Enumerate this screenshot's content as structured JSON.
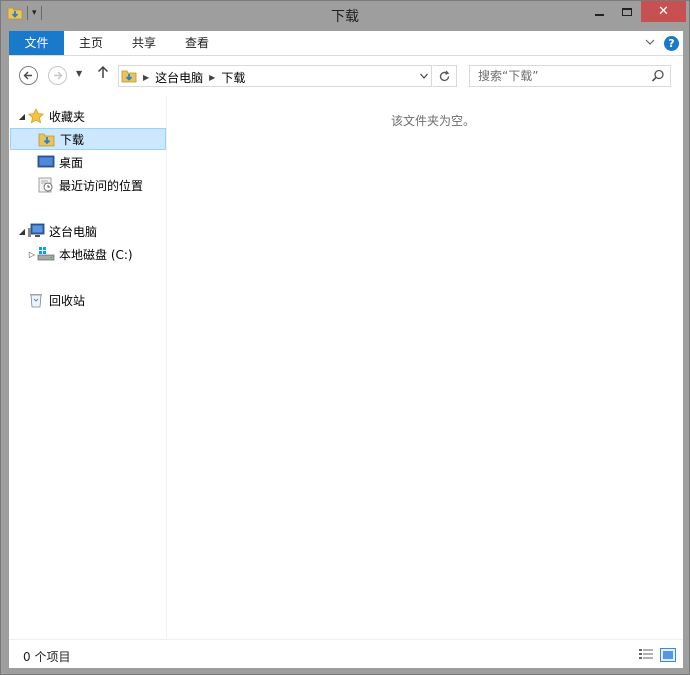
{
  "window": {
    "title": "下载"
  },
  "ribbon": {
    "tabs": [
      {
        "label": "文件"
      },
      {
        "label": "主页"
      },
      {
        "label": "共享"
      },
      {
        "label": "查看"
      }
    ],
    "help_label": "?"
  },
  "address": {
    "crumbs": [
      "这台电脑",
      "下载"
    ],
    "search_placeholder": "搜索“下载”"
  },
  "navpane": {
    "favorites_label": "收藏夹",
    "favorites": [
      {
        "label": "下载",
        "selected": true
      },
      {
        "label": "桌面"
      },
      {
        "label": "最近访问的位置"
      }
    ],
    "this_pc_label": "这台电脑",
    "drives": [
      {
        "label": "本地磁盘 (C:)"
      }
    ],
    "recycle_label": "回收站"
  },
  "content": {
    "empty_message": "该文件夹为空。"
  },
  "status": {
    "item_count": "0 个项目"
  },
  "colors": {
    "accent": "#1979ca",
    "close_button": "#c75050",
    "selection_bg": "#cce8ff",
    "selection_border": "#99d1ff"
  },
  "icons": {
    "back": "arrow-left-icon",
    "forward": "arrow-right-icon",
    "up": "arrow-up-icon",
    "refresh": "refresh-icon",
    "search": "search-icon",
    "help": "help-icon"
  }
}
